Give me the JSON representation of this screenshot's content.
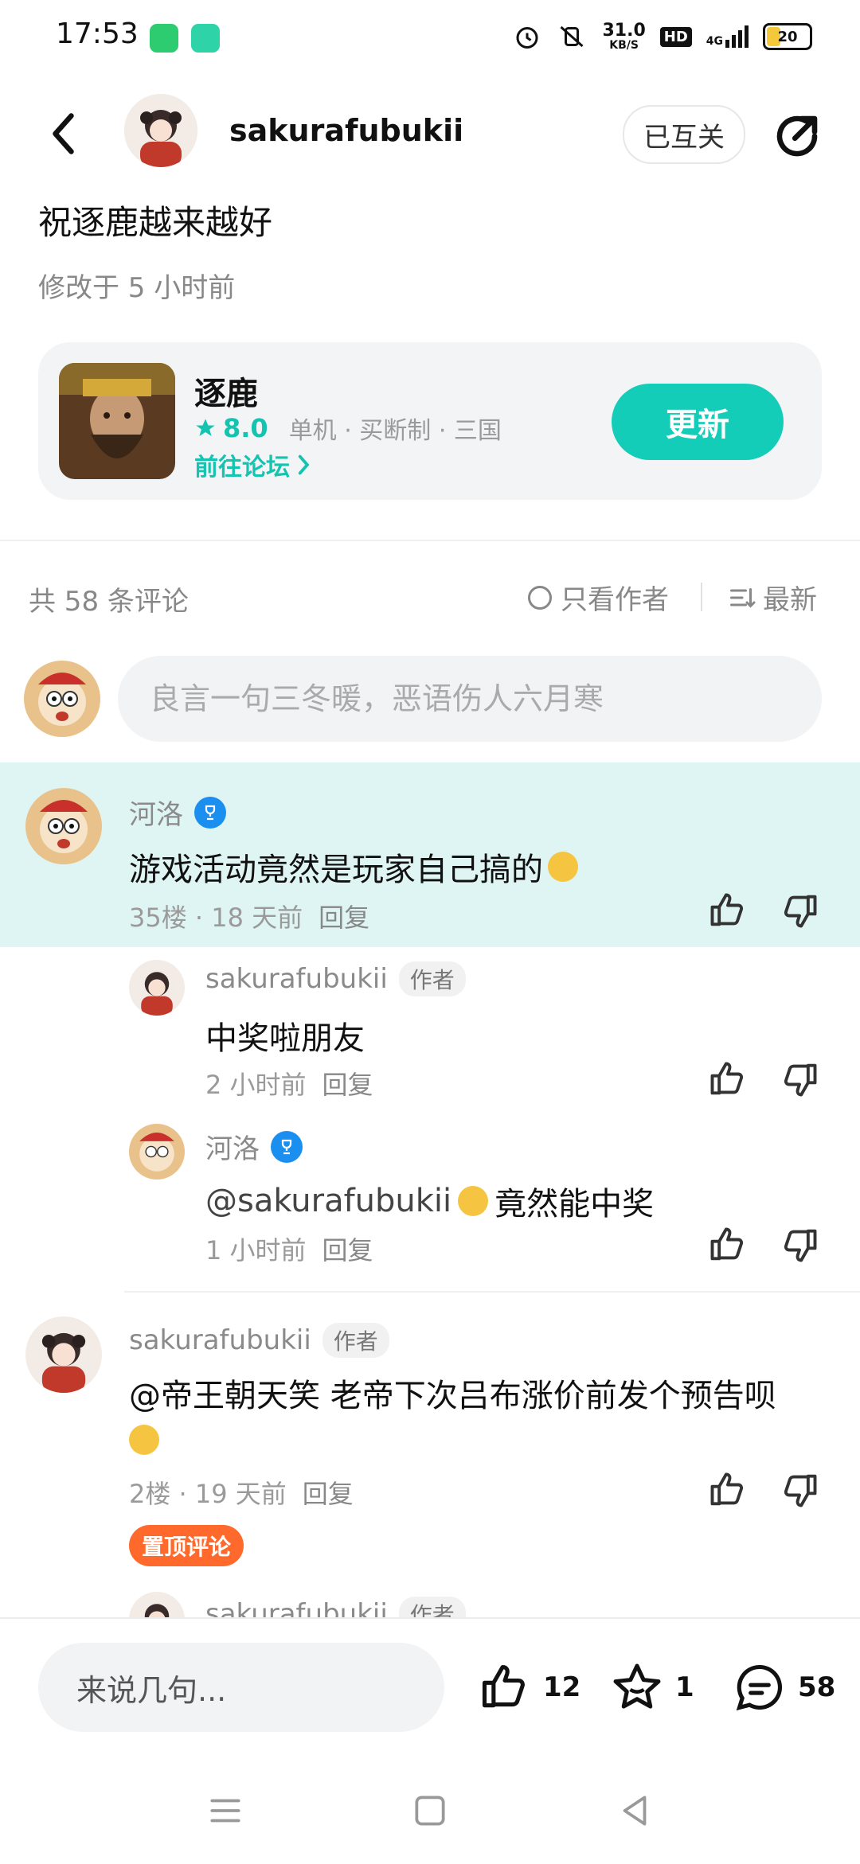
{
  "status_bar": {
    "time": "17:53",
    "network_speed": "31.0",
    "network_unit": "KB/S",
    "hd": "HD",
    "signal_label": "4G",
    "battery": "20"
  },
  "header": {
    "username": "sakurafubukii",
    "follow_label": "已互关",
    "back_icon": "back-arrow-icon",
    "share_icon": "share-icon"
  },
  "post": {
    "title": "祝逐鹿越来越好",
    "meta": "修改于 5 小时前"
  },
  "game_card": {
    "name": "逐鹿",
    "rating": "8.0",
    "tags": "单机 · 买断制 · 三国",
    "forum_link": "前往论坛",
    "update_button": "更新",
    "accent": "#14cdb8"
  },
  "comments_header": {
    "count": "共 58 条评论",
    "only_author": "只看作者",
    "sort": "最新"
  },
  "comment_input": {
    "placeholder": "良言一句三冬暖，恶语伤人六月寒"
  },
  "comments": [
    {
      "user": "河洛",
      "text": "游戏活动竟然是玩家自己搞的",
      "meta": "35楼 · 18 天前",
      "reply": "回复",
      "replies": [
        {
          "user": "sakurafubukii",
          "badge": "作者",
          "text": "中奖啦朋友",
          "meta": "2 小时前",
          "reply": "回复"
        },
        {
          "user": "河洛",
          "text": "@sakurafubukii ",
          "text2": "竟然能中奖",
          "meta": "1 小时前",
          "reply": "回复"
        }
      ]
    },
    {
      "user": "sakurafubukii",
      "badge": "作者",
      "text": "@帝王朝天笑 老帝下次吕布涨价前发个预告呗",
      "meta": "2楼 · 19 天前",
      "reply": "回复",
      "pin": "置顶评论"
    },
    {
      "user": "sakurafubukii",
      "badge": "作者"
    }
  ],
  "bottom_bar": {
    "input_placeholder": "来说几句...",
    "likes": "12",
    "favorites": "1",
    "comments": "58"
  }
}
